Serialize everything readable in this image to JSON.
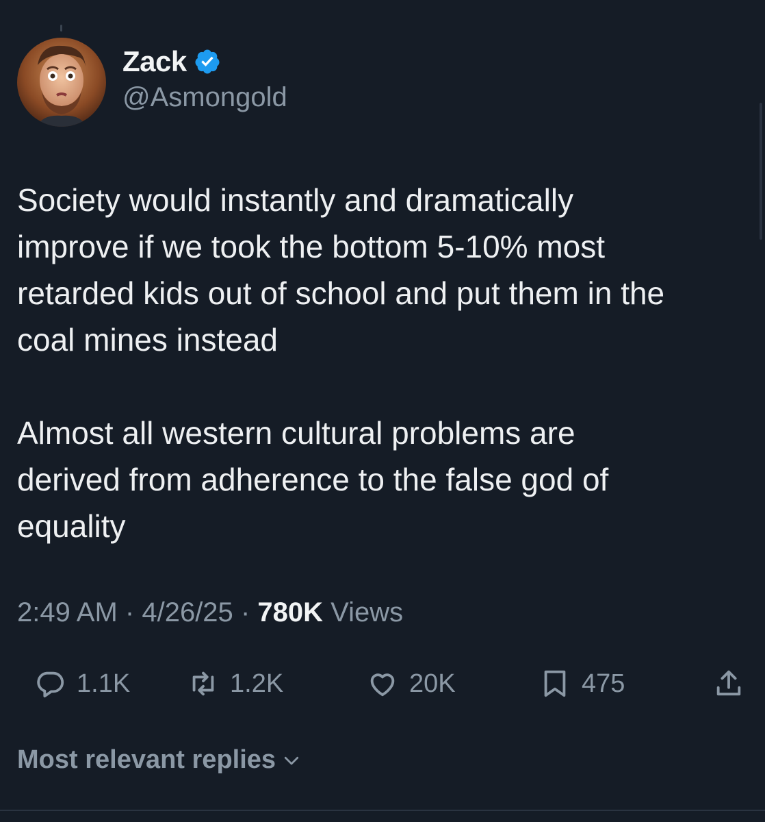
{
  "author": {
    "display_name": "Zack",
    "handle": "@Asmongold",
    "verified_icon": "verified-badge-icon",
    "badge_color": "#1d9bf0"
  },
  "tweet": {
    "text": "Society would instantly and dramatically\nimprove if we took the bottom 5-10% most\nretarded kids out of school and put them in the\ncoal mines instead\n\nAlmost all western cultural problems are\nderived from adherence to the false god of\nequality"
  },
  "meta": {
    "time": "2:49 AM",
    "separator": "·",
    "date": "4/26/25",
    "views_count": "780K",
    "views_label": "Views"
  },
  "actions": {
    "reply_count": "1.1K",
    "repost_count": "1.2K",
    "like_count": "20K",
    "bookmark_count": "475",
    "icons": [
      "reply-icon",
      "repost-icon",
      "like-icon",
      "bookmark-icon",
      "share-icon"
    ]
  },
  "replies": {
    "sort_label": "Most relevant replies"
  },
  "colors": {
    "background": "#151c26",
    "text_primary": "#eef0f2",
    "text_secondary": "#8b98a5"
  }
}
